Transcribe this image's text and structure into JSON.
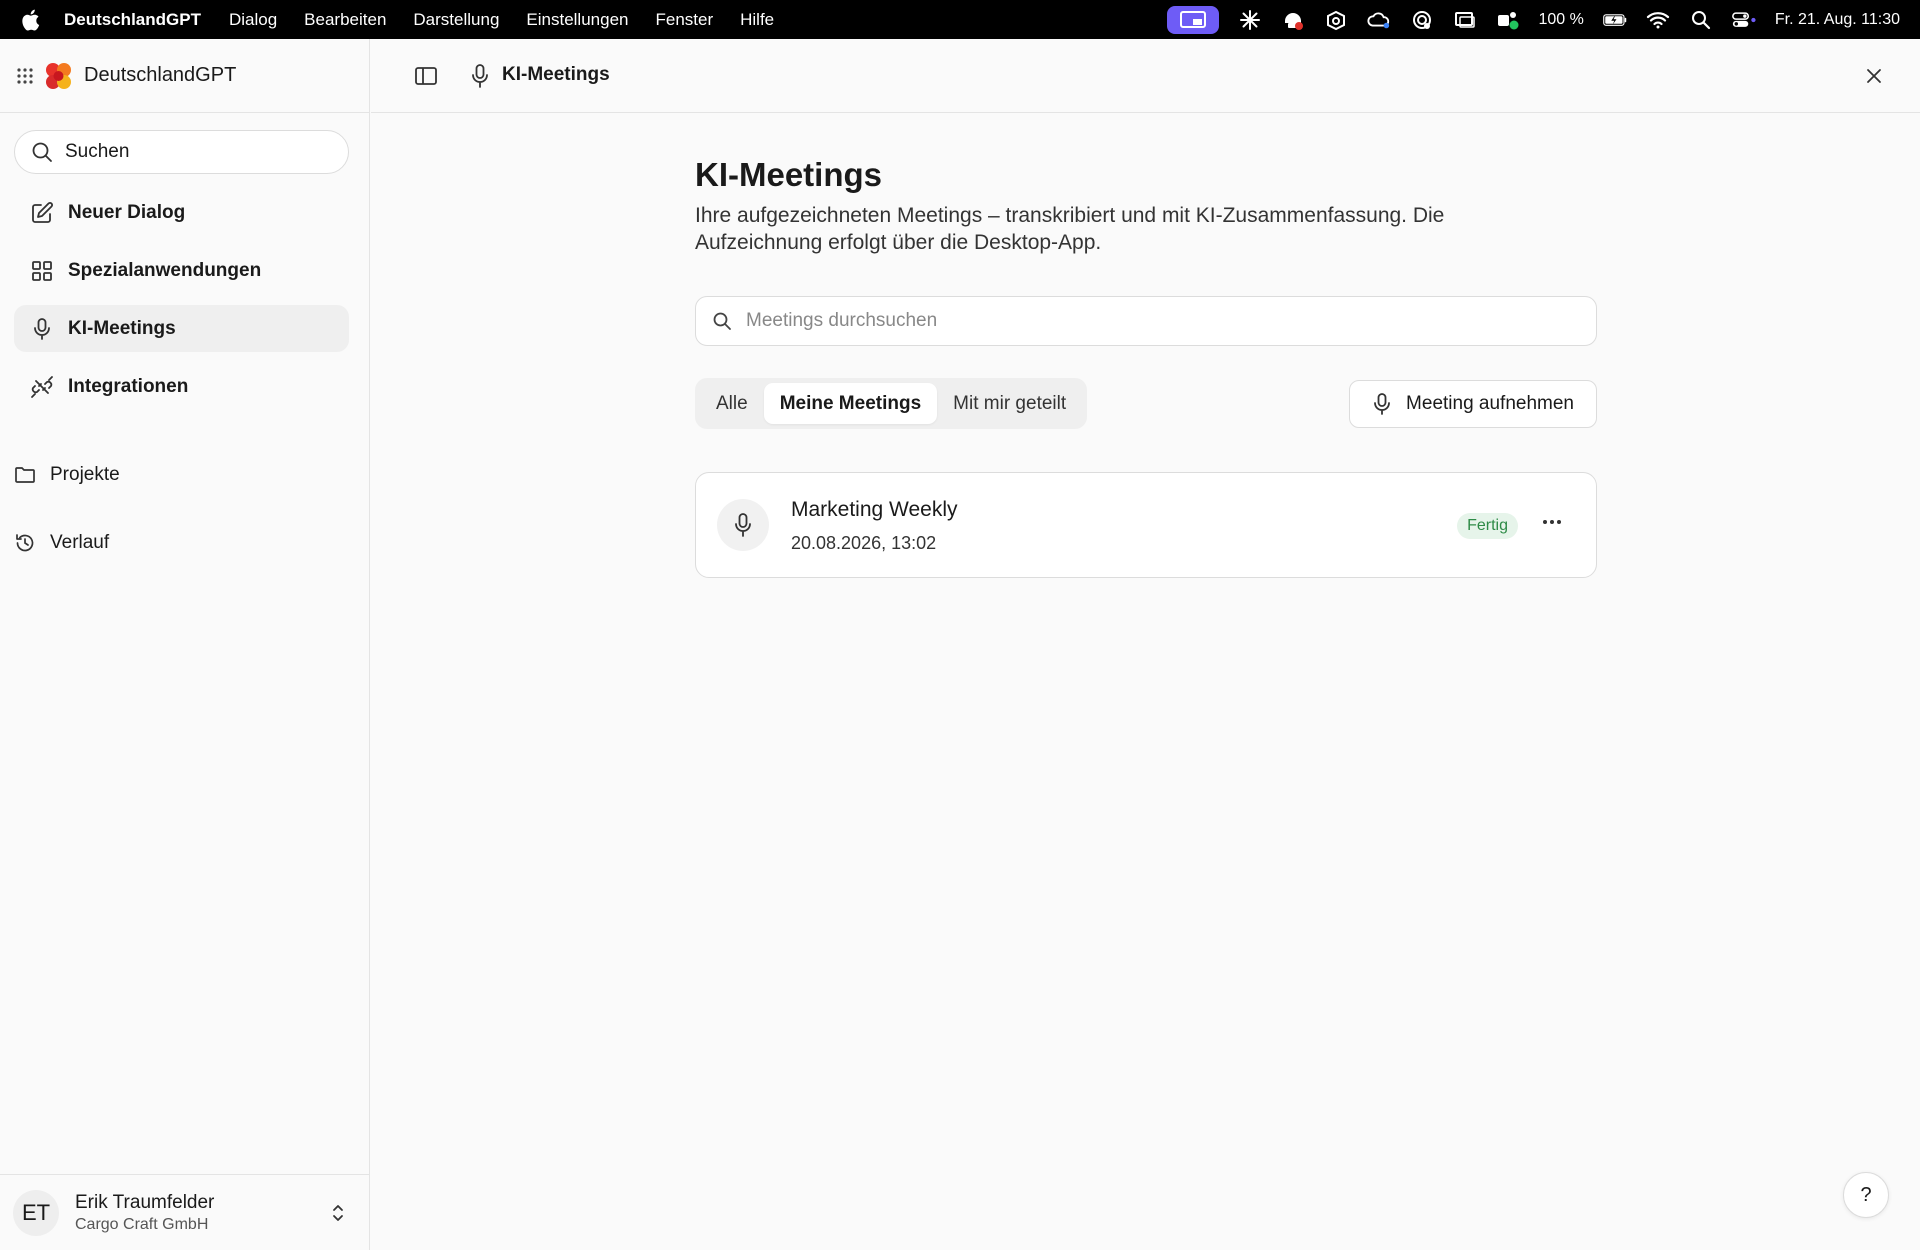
{
  "menubar": {
    "app_name": "DeutschlandGPT",
    "items": [
      "Dialog",
      "Bearbeiten",
      "Darstellung",
      "Einstellungen",
      "Fenster",
      "Hilfe"
    ],
    "battery": "100 %",
    "datetime": "Fr. 21. Aug.  11:30"
  },
  "sidebar": {
    "brand": "DeutschlandGPT",
    "search_label": "Suchen",
    "nav": [
      {
        "label": "Neuer Dialog",
        "icon": "edit-icon"
      },
      {
        "label": "Spezialanwendungen",
        "icon": "grid-icon"
      },
      {
        "label": "KI-Meetings",
        "icon": "microphone-icon"
      },
      {
        "label": "Integrationen",
        "icon": "plug-icon"
      }
    ],
    "sections": [
      {
        "label": "Projekte",
        "icon": "folder-icon"
      },
      {
        "label": "Verlauf",
        "icon": "history-icon"
      }
    ],
    "user": {
      "initials": "ET",
      "name": "Erik Traumfelder",
      "company": "Cargo Craft GmbH"
    }
  },
  "topbar": {
    "title": "KI-Meetings"
  },
  "main": {
    "title": "KI-Meetings",
    "description": "Ihre aufgezeichneten Meetings – transkribiert und mit KI-Zusammenfassung. Die Aufzeichnung erfolgt über die Desktop-App.",
    "search_placeholder": "Meetings durchsuchen",
    "tabs": [
      "Alle",
      "Meine Meetings",
      "Mit mir geteilt"
    ],
    "active_tab": "Meine Meetings",
    "record_button": "Meeting aufnehmen",
    "meetings": [
      {
        "title": "Marketing Weekly",
        "date": "20.08.2026, 13:02",
        "status": "Fertig"
      }
    ]
  },
  "help_label": "?",
  "colors": {
    "accent_purple": "#6e5cf6",
    "status_green": "#2e8b47",
    "status_green_bg": "#e6f4ea"
  }
}
